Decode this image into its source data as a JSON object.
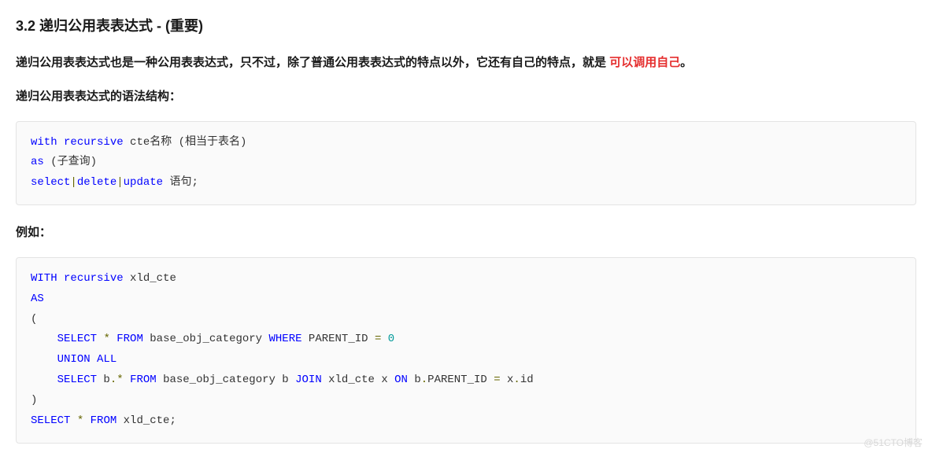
{
  "heading": "3.2 递归公用表表达式 - (重要)",
  "intro": {
    "prefix": "递归公用表表达式也是一种公用表表达式，只不过，除了普通公用表表达式的特点以外，它还有自己的特点，就是 ",
    "highlight": "可以调用自己",
    "suffix": "。"
  },
  "syntax_label": "递归公用表表达式的语法结构：",
  "example_label": "例如：",
  "code1": {
    "tokens": [
      [
        {
          "t": "with",
          "c": "kw"
        },
        {
          "t": " "
        },
        {
          "t": "recursive",
          "c": "kw"
        },
        {
          "t": " cte名称 (相当于表名)"
        }
      ],
      [
        {
          "t": "as",
          "c": "kw"
        },
        {
          "t": " (子查询)"
        }
      ],
      [
        {
          "t": "select",
          "c": "kw"
        },
        {
          "t": "|",
          "c": "op"
        },
        {
          "t": "delete",
          "c": "kw"
        },
        {
          "t": "|",
          "c": "op"
        },
        {
          "t": "update",
          "c": "kw"
        },
        {
          "t": " 语句;"
        }
      ]
    ]
  },
  "code2": {
    "tokens": [
      [
        {
          "t": "WITH",
          "c": "kw"
        },
        {
          "t": " "
        },
        {
          "t": "recursive",
          "c": "kw"
        },
        {
          "t": " xld_cte"
        }
      ],
      [
        {
          "t": "AS",
          "c": "kw"
        }
      ],
      [
        {
          "t": "("
        }
      ],
      [
        {
          "t": "    "
        },
        {
          "t": "SELECT",
          "c": "kw"
        },
        {
          "t": " "
        },
        {
          "t": "*",
          "c": "op"
        },
        {
          "t": " "
        },
        {
          "t": "FROM",
          "c": "kw"
        },
        {
          "t": " base_obj_category "
        },
        {
          "t": "WHERE",
          "c": "kw"
        },
        {
          "t": " PARENT_ID "
        },
        {
          "t": "=",
          "c": "op"
        },
        {
          "t": " "
        },
        {
          "t": "0",
          "c": "num"
        }
      ],
      [
        {
          "t": "    "
        },
        {
          "t": "UNION",
          "c": "kw"
        },
        {
          "t": " "
        },
        {
          "t": "ALL",
          "c": "kw"
        }
      ],
      [
        {
          "t": "    "
        },
        {
          "t": "SELECT",
          "c": "kw"
        },
        {
          "t": " b"
        },
        {
          "t": ".",
          "c": "op"
        },
        {
          "t": "*",
          "c": "op"
        },
        {
          "t": " "
        },
        {
          "t": "FROM",
          "c": "kw"
        },
        {
          "t": " base_obj_category b "
        },
        {
          "t": "JOIN",
          "c": "kw"
        },
        {
          "t": " xld_cte x "
        },
        {
          "t": "ON",
          "c": "kw"
        },
        {
          "t": " b"
        },
        {
          "t": ".",
          "c": "op"
        },
        {
          "t": "PARENT_ID "
        },
        {
          "t": "=",
          "c": "op"
        },
        {
          "t": " x"
        },
        {
          "t": ".",
          "c": "op"
        },
        {
          "t": "id"
        }
      ],
      [
        {
          "t": ")"
        }
      ],
      [
        {
          "t": "SELECT",
          "c": "kw"
        },
        {
          "t": " "
        },
        {
          "t": "*",
          "c": "op"
        },
        {
          "t": " "
        },
        {
          "t": "FROM",
          "c": "kw"
        },
        {
          "t": " xld_cte;"
        }
      ]
    ]
  },
  "watermark": "@51CTO博客"
}
